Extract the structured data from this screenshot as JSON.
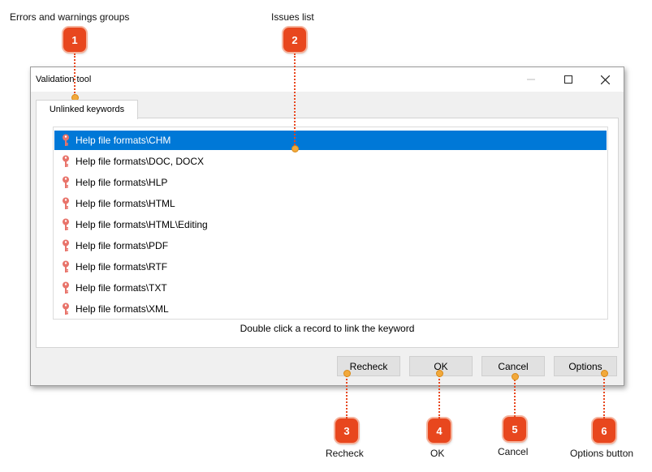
{
  "callouts": [
    {
      "number": "1",
      "label": "Errors and warnings groups"
    },
    {
      "number": "2",
      "label": "Issues list"
    },
    {
      "number": "3",
      "label": "Recheck"
    },
    {
      "number": "4",
      "label": "OK"
    },
    {
      "number": "5",
      "label": "Cancel"
    },
    {
      "number": "6",
      "label": "Options button"
    }
  ],
  "window": {
    "title": "Validation tool",
    "controls": {
      "minimize": "minimize-icon",
      "maximize": "maximize-icon",
      "close": "close-icon"
    }
  },
  "tabs": [
    {
      "label": "Unlinked keywords",
      "active": true
    }
  ],
  "issues": [
    {
      "text": "Help file formats\\CHM",
      "icon": "key-icon",
      "selected": true
    },
    {
      "text": "Help file formats\\DOC, DOCX",
      "icon": "key-icon"
    },
    {
      "text": "Help file formats\\HLP",
      "icon": "key-icon"
    },
    {
      "text": "Help file formats\\HTML",
      "icon": "key-icon"
    },
    {
      "text": "Help file formats\\HTML\\Editing",
      "icon": "key-icon"
    },
    {
      "text": "Help file formats\\PDF",
      "icon": "key-icon"
    },
    {
      "text": "Help file formats\\RTF",
      "icon": "key-icon"
    },
    {
      "text": "Help file formats\\TXT",
      "icon": "key-icon"
    },
    {
      "text": "Help file formats\\XML",
      "icon": "key-icon"
    }
  ],
  "hint": "Double click a record to link the keyword",
  "buttons": {
    "recheck": "Recheck",
    "ok": "OK",
    "cancel": "Cancel",
    "options": "Options"
  },
  "colors": {
    "accent": "#e8471e",
    "selection": "#0078d7",
    "dot": "#f2a93b"
  }
}
